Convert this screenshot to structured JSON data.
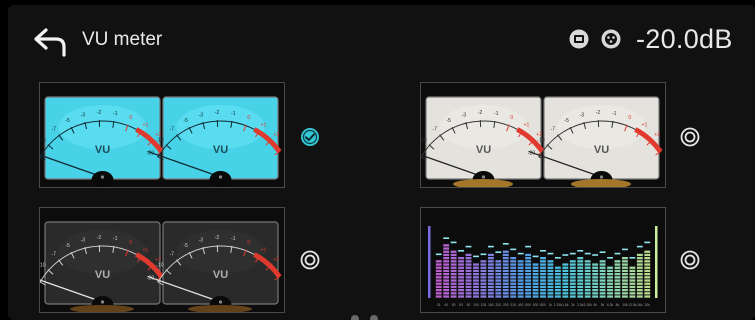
{
  "header": {
    "title": "VU meter",
    "level": "-20.0dB",
    "icons": [
      "back-arrow-icon",
      "input-source-icon",
      "xlr-connector-icon"
    ]
  },
  "meter_scale": [
    "-20",
    "-10",
    "-7",
    "-5",
    "-3",
    "-2",
    "-1",
    "0",
    "+1",
    "+2",
    "+3"
  ],
  "meter_label": "VU",
  "styles": [
    {
      "name": "blue",
      "selected": true
    },
    {
      "name": "white",
      "selected": false
    },
    {
      "name": "black",
      "selected": false
    },
    {
      "name": "spectrum",
      "selected": false
    }
  ],
  "spectrum_bands": [
    "31",
    "40",
    "50",
    "63",
    "80",
    "100",
    "125",
    "160",
    "200",
    "250",
    "315",
    "400",
    "500",
    "630",
    "800",
    "1k",
    "1.25k",
    "1.6k",
    "2k",
    "2.5k",
    "3.15k",
    "4k",
    "5k",
    "6.3k",
    "8k",
    "10k",
    "12.5k",
    "16k",
    "20k"
  ],
  "colors": {
    "accent": "#34c6d4",
    "blue_face": "#48d2e8",
    "white_face": "#e4e2dd",
    "dark_face": "#2a2a2a"
  }
}
